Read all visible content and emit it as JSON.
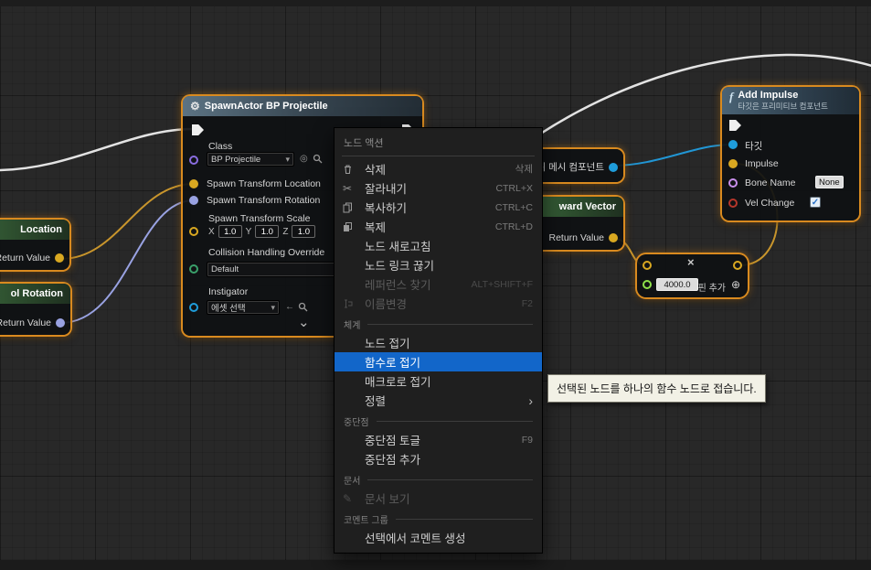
{
  "colors": {
    "selection_orange": "#d98a1f",
    "menu_highlight": "#1266c9",
    "exec_wire": "#e3e3e3",
    "vector_pin": "#d9a821",
    "rotator_pin": "#99a2e2",
    "object_pin": "#1f9ddb",
    "float_pin": "#8ee04a",
    "bool_pin": "#b5362b",
    "enum_pin": "#3aa06a",
    "class_pin": "#8a6de0",
    "name_pin": "#c88fec"
  },
  "spawn_node": {
    "title": "SpawnActor BP Projectile",
    "class_label": "Class",
    "class_value": "BP Projectile",
    "pin_location": "Spawn Transform Location",
    "pin_rotation": "Spawn Transform Rotation",
    "scale_label": "Spawn Transform Scale",
    "x_label": "X",
    "y_label": "Y",
    "z_label": "Z",
    "scale_x": "1.0",
    "scale_y": "1.0",
    "scale_z": "1.0",
    "collision_label": "Collision Handling Override",
    "collision_value": "Default",
    "instigator_label": "Instigator",
    "instigator_value": "에셋 선택"
  },
  "location_node": {
    "title": "Location",
    "pin": "Return Value"
  },
  "rotation_node": {
    "title": "ol Rotation",
    "pin": "Return Value"
  },
  "forward_node": {
    "title": "ward Vector",
    "pin": "Return Value"
  },
  "mesh_node": {
    "title": "뒤 메시 컴포넌트"
  },
  "impulse_node": {
    "fn_glyph": "f",
    "title": "Add Impulse",
    "subtitle": "타깃은 프리미티브 컴포넌트",
    "pin_target": "타깃",
    "pin_impulse": "Impulse",
    "pin_bone": "Bone Name",
    "bone_value": "None",
    "pin_velchange": "Vel Change"
  },
  "multiply_node": {
    "op": "×",
    "value": "4000.0",
    "add_pin": "핀 추가",
    "add_pin_glyph": "⊕"
  },
  "menu": {
    "title": "노드 액션",
    "items": [
      {
        "label": "삭제",
        "shortcut": "삭제"
      },
      {
        "label": "잘라내기",
        "shortcut": "CTRL+X"
      },
      {
        "label": "복사하기",
        "shortcut": "CTRL+C"
      },
      {
        "label": "복제",
        "shortcut": "CTRL+D"
      },
      {
        "label": "노드 새로고침",
        "shortcut": ""
      },
      {
        "label": "노드 링크 끊기",
        "shortcut": ""
      },
      {
        "label": "레퍼런스 찾기",
        "shortcut": "ALT+SHIFT+F"
      },
      {
        "label": "이름변경",
        "shortcut": "F2"
      }
    ],
    "sections": {
      "organization": "체계",
      "breakpoints": "중단점",
      "documentation": "문서",
      "comment": "코멘트 그룹"
    },
    "org_items": [
      {
        "label": "노드 접기"
      },
      {
        "label": "함수로 접기"
      },
      {
        "label": "매크로로 접기"
      },
      {
        "label": "정렬"
      }
    ],
    "bp_items": [
      {
        "label": "중단점 토글",
        "shortcut": "F9"
      },
      {
        "label": "중단점 추가",
        "shortcut": ""
      }
    ],
    "doc_items": [
      {
        "label": "문서 보기"
      }
    ],
    "comment_items": [
      {
        "label": "선택에서 코멘트 생성"
      }
    ]
  },
  "tooltip": {
    "text": "선택된 노드를 하나의 함수 노드로 접습니다."
  }
}
